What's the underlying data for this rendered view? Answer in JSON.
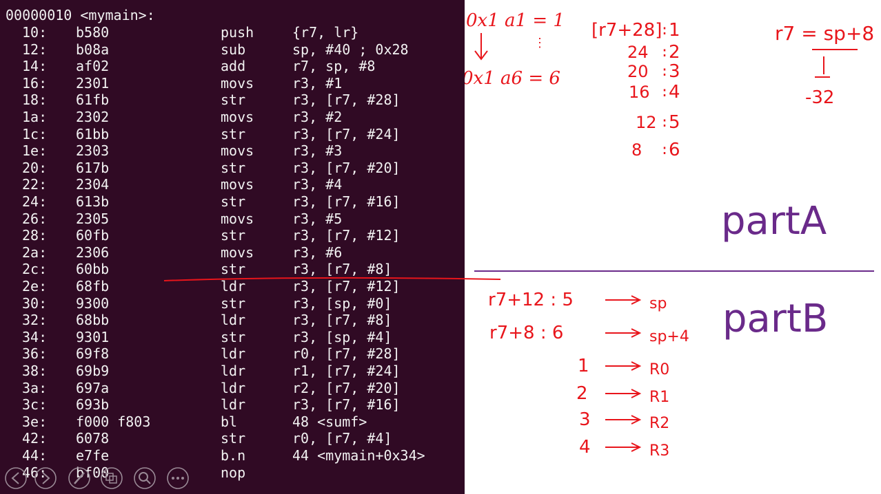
{
  "terminal": {
    "header": "00000010 <mymain>:",
    "rows": [
      {
        "addr": "10:",
        "hex": "b580",
        "mnemonic": "push",
        "operands": "{r7, lr}"
      },
      {
        "addr": "12:",
        "hex": "b08a",
        "mnemonic": "sub",
        "operands": "sp, #40 ; 0x28"
      },
      {
        "addr": "14:",
        "hex": "af02",
        "mnemonic": "add",
        "operands": "r7, sp, #8"
      },
      {
        "addr": "16:",
        "hex": "2301",
        "mnemonic": "movs",
        "operands": "r3, #1"
      },
      {
        "addr": "18:",
        "hex": "61fb",
        "mnemonic": "str",
        "operands": "r3, [r7, #28]"
      },
      {
        "addr": "1a:",
        "hex": "2302",
        "mnemonic": "movs",
        "operands": "r3, #2"
      },
      {
        "addr": "1c:",
        "hex": "61bb",
        "mnemonic": "str",
        "operands": "r3, [r7, #24]"
      },
      {
        "addr": "1e:",
        "hex": "2303",
        "mnemonic": "movs",
        "operands": "r3, #3"
      },
      {
        "addr": "20:",
        "hex": "617b",
        "mnemonic": "str",
        "operands": "r3, [r7, #20]"
      },
      {
        "addr": "22:",
        "hex": "2304",
        "mnemonic": "movs",
        "operands": "r3, #4"
      },
      {
        "addr": "24:",
        "hex": "613b",
        "mnemonic": "str",
        "operands": "r3, [r7, #16]"
      },
      {
        "addr": "26:",
        "hex": "2305",
        "mnemonic": "movs",
        "operands": "r3, #5"
      },
      {
        "addr": "28:",
        "hex": "60fb",
        "mnemonic": "str",
        "operands": "r3, [r7, #12]"
      },
      {
        "addr": "2a:",
        "hex": "2306",
        "mnemonic": "movs",
        "operands": "r3, #6"
      },
      {
        "addr": "2c:",
        "hex": "60bb",
        "mnemonic": "str",
        "operands": "r3, [r7, #8]"
      },
      {
        "addr": "2e:",
        "hex": "68fb",
        "mnemonic": "ldr",
        "operands": "r3, [r7, #12]"
      },
      {
        "addr": "30:",
        "hex": "9300",
        "mnemonic": "str",
        "operands": "r3, [sp, #0]"
      },
      {
        "addr": "32:",
        "hex": "68bb",
        "mnemonic": "ldr",
        "operands": "r3, [r7, #8]"
      },
      {
        "addr": "34:",
        "hex": "9301",
        "mnemonic": "str",
        "operands": "r3, [sp, #4]"
      },
      {
        "addr": "36:",
        "hex": "69f8",
        "mnemonic": "ldr",
        "operands": "r0, [r7, #28]"
      },
      {
        "addr": "38:",
        "hex": "69b9",
        "mnemonic": "ldr",
        "operands": "r1, [r7, #24]"
      },
      {
        "addr": "3a:",
        "hex": "697a",
        "mnemonic": "ldr",
        "operands": "r2, [r7, #20]"
      },
      {
        "addr": "3c:",
        "hex": "693b",
        "mnemonic": "ldr",
        "operands": "r3, [r7, #16]"
      },
      {
        "addr": "3e:",
        "hex": "f000 f803",
        "mnemonic": "bl",
        "operands": "48 <sumf>"
      },
      {
        "addr": "42:",
        "hex": "6078",
        "mnemonic": "str",
        "operands": "r0, [r7, #4]"
      },
      {
        "addr": "44:",
        "hex": "e7fe",
        "mnemonic": "b.n",
        "operands": "44 <mymain+0x34>"
      },
      {
        "addr": "46:",
        "hex": "bf00",
        "mnemonic": "nop",
        "operands": ""
      }
    ],
    "background": "#300a24",
    "text_color": "#f2f2f2"
  },
  "controls": {
    "icons": [
      "arrow-left-icon",
      "arrow-right-icon",
      "pen-icon",
      "slides-icon",
      "magnifier-icon",
      "more-icon"
    ]
  },
  "annotations": {
    "ink_red": "#e8151b",
    "ink_purple": "#6a2a8a",
    "partA": {
      "label": "partA",
      "left": [
        "0x1 a1 = 1",
        "⋮",
        "0x1 a6 = 6"
      ],
      "offsets": [
        {
          "off": "[r7+28]",
          "val": "1"
        },
        {
          "off": "24",
          "val": "2"
        },
        {
          "off": "20",
          "val": "3"
        },
        {
          "off": "16",
          "val": "4"
        },
        {
          "off": "12",
          "val": "5"
        },
        {
          "off": "8",
          "val": "6"
        }
      ],
      "r7_note": "r7 = sp+8",
      "r7_result": "-32"
    },
    "partB": {
      "label": "partB",
      "rows": [
        {
          "src": "r7+12 : 5",
          "dst": "sp"
        },
        {
          "src": "r7+8 : 6",
          "dst": "sp+4"
        },
        {
          "src": "1",
          "dst": "R0"
        },
        {
          "src": "2",
          "dst": "R1"
        },
        {
          "src": "3",
          "dst": "R2"
        },
        {
          "src": "4",
          "dst": "R3"
        }
      ]
    }
  }
}
